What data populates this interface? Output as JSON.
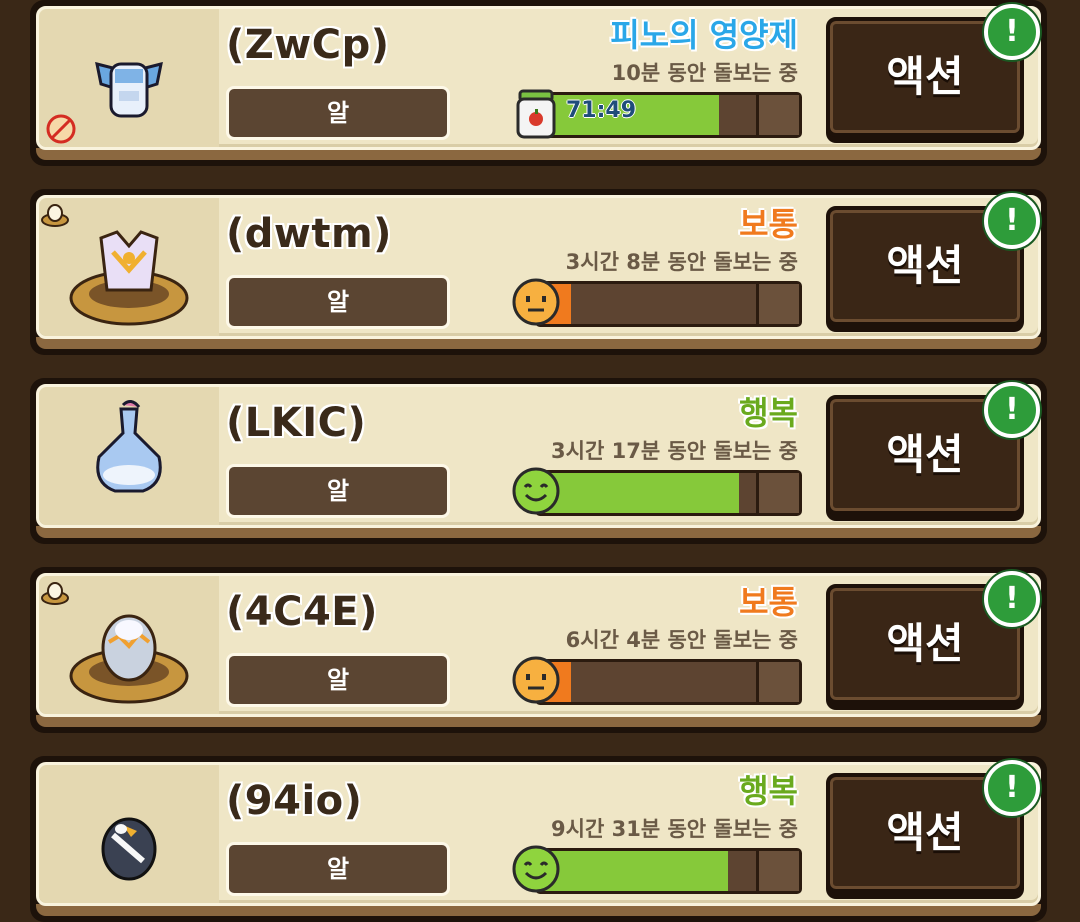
{
  "pets": [
    {
      "name": "(ZwCp)",
      "stage": "알",
      "status": "피노의 영양제",
      "status_color": "#2aa7e8",
      "duration": "10분 동안 돌보는 중",
      "bar_label": "71:49",
      "fill_percent": 70,
      "fill_color": "#86c93a",
      "bar_icon": "jar-icon",
      "action": "액션",
      "alert": "!"
    },
    {
      "name": "(dwtm)",
      "stage": "알",
      "status": "보통",
      "status_color": "#f07a1e",
      "duration": "3시간 8분 동안 돌보는 중",
      "bar_label": "",
      "fill_percent": 3,
      "fill_color": "#f07a1e",
      "bar_icon": "neutral-face-icon",
      "action": "액션",
      "alert": "!"
    },
    {
      "name": "(LKIC)",
      "stage": "알",
      "status": "행복",
      "status_color": "#6aaa1e",
      "duration": "3시간 17분 동안 돌보는 중",
      "bar_label": "",
      "fill_percent": 79,
      "fill_color": "#86c93a",
      "bar_icon": "happy-face-icon",
      "action": "액션",
      "alert": "!"
    },
    {
      "name": "(4C4E)",
      "stage": "알",
      "status": "보통",
      "status_color": "#f07a1e",
      "duration": "6시간 4분 동안 돌보는 중",
      "bar_label": "",
      "fill_percent": 3,
      "fill_color": "#f07a1e",
      "bar_icon": "neutral-face-icon",
      "action": "액션",
      "alert": "!"
    },
    {
      "name": "(94io)",
      "stage": "알",
      "status": "행복",
      "status_color": "#6aaa1e",
      "duration": "9시간 31분 동안 돌보는 중",
      "bar_label": "",
      "fill_percent": 74,
      "fill_color": "#86c93a",
      "bar_icon": "happy-face-icon",
      "action": "액션",
      "alert": "!"
    }
  ]
}
